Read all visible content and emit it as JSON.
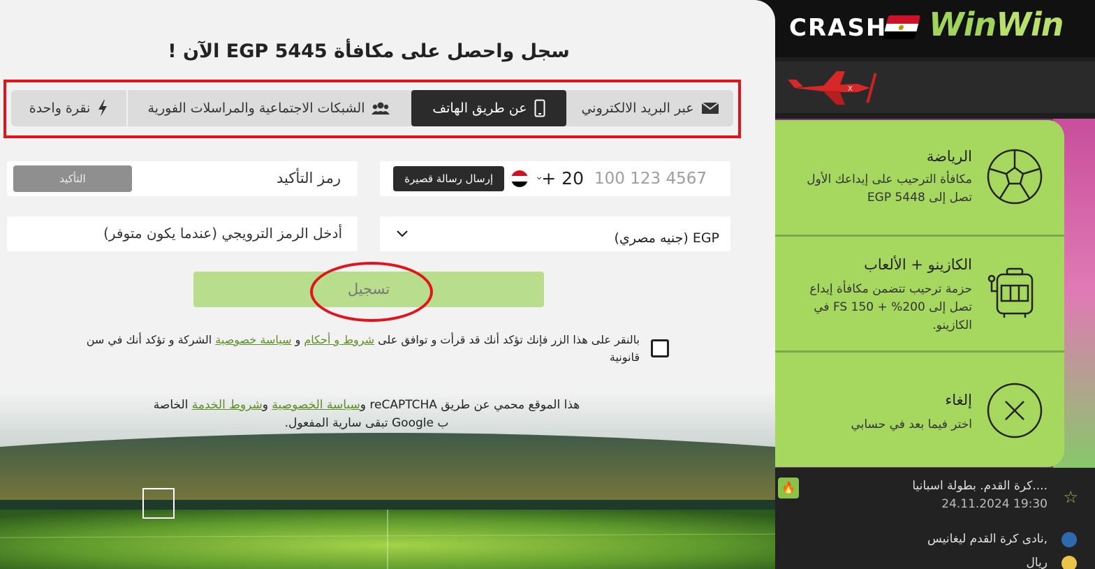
{
  "header": {
    "crash_label": "CRASH",
    "logo_win1": "Win",
    "logo_win2": "Win"
  },
  "modal": {
    "title": "سجل واحصل على مكافأة EGP 5445 الآن !",
    "tabs": [
      {
        "label": "عبر البريد الالكتروني",
        "icon": "envelope-icon",
        "active": false
      },
      {
        "label": "عن طريق الهاتف",
        "icon": "smartphone-icon",
        "active": true
      },
      {
        "label": "الشبكات الاجتماعية والمراسلات الفورية",
        "icon": "users-icon",
        "active": false
      },
      {
        "label": "نقرة واحدة",
        "icon": "lightning-icon",
        "active": false
      }
    ],
    "phone": {
      "placeholder": "100 123 4567",
      "country_code": "+ 20",
      "sms_button": "إرسال رسالة قصيرة"
    },
    "confirmation": {
      "label": "رمز التأكيد",
      "button": "التأكيد"
    },
    "currency": {
      "value": "EGP (جنيه مصري)"
    },
    "promo": {
      "placeholder": "أدخل الرمز الترويجي (عندما يكون متوفر)"
    },
    "register_button": "تسجيل",
    "terms": {
      "part1": "بالنقر على هذا الزر فإنك تؤكد أنك قد قرأت و توافق على ",
      "link1": "شروط و أحكام",
      "part2": " و ",
      "link2": "سياسة خصوصية",
      "part3": " الشركة و تؤكد أنك في سن قانونية"
    },
    "captcha": {
      "part1": "هذا الموقع محمي عن طريق reCAPTCHA و",
      "link1": "سياسة الخصوصية",
      "part2": " و",
      "link2": "شروط الخدمة",
      "part3": " الخاصة ب Google تبقى سارية المفعول."
    }
  },
  "bonus_panel": {
    "items": [
      {
        "title": "الرياضة",
        "desc": "مكافأة الترحيب على إيداعك الأول تصل إلى EGP 5448",
        "icon": "soccer-ball-icon"
      },
      {
        "title": "الكازينو + الألعاب",
        "desc": "حزمة ترحيب تتضمن مكافأة إيداع تصل إلى 200% + 150 FS في الكازينو.",
        "icon": "slot-machine-icon"
      },
      {
        "title": "إلغاء",
        "desc": "اختر فيما بعد في حسابي",
        "icon": "close-circle-icon"
      }
    ]
  },
  "match": {
    "title": "كرة القدم. بطولة اسبانيا....",
    "time": "24.11.2024 19:30",
    "team1": "نادى كرة القدم ليغانيس,",
    "team2": "ريال"
  },
  "colors": {
    "accent_green": "#a6d75f",
    "register_green": "#b8dd8c",
    "highlight_red": "#e1141c",
    "dark": "#2b2b2b"
  }
}
